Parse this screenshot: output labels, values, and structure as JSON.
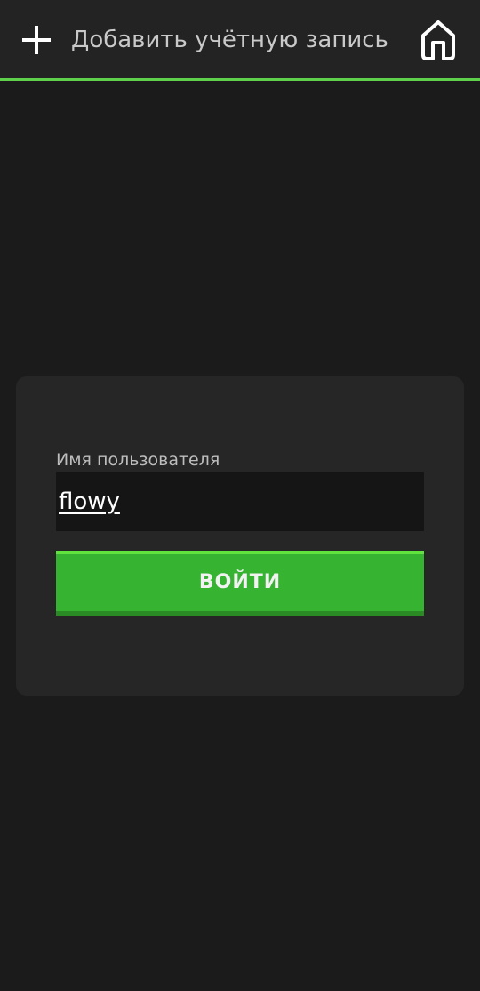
{
  "header": {
    "add_icon": "plus-icon",
    "title": "Добавить учётную запись",
    "home_icon": "home-icon"
  },
  "login_form": {
    "username_label": "Имя пользователя",
    "username_value": "flowy",
    "submit_label": "ВОЙТИ"
  },
  "colors": {
    "background": "#1b1b1b",
    "header_background": "#232323",
    "accent": "#5fd04b",
    "card_background": "#262626",
    "input_background": "#151515",
    "button": "#37b332"
  }
}
